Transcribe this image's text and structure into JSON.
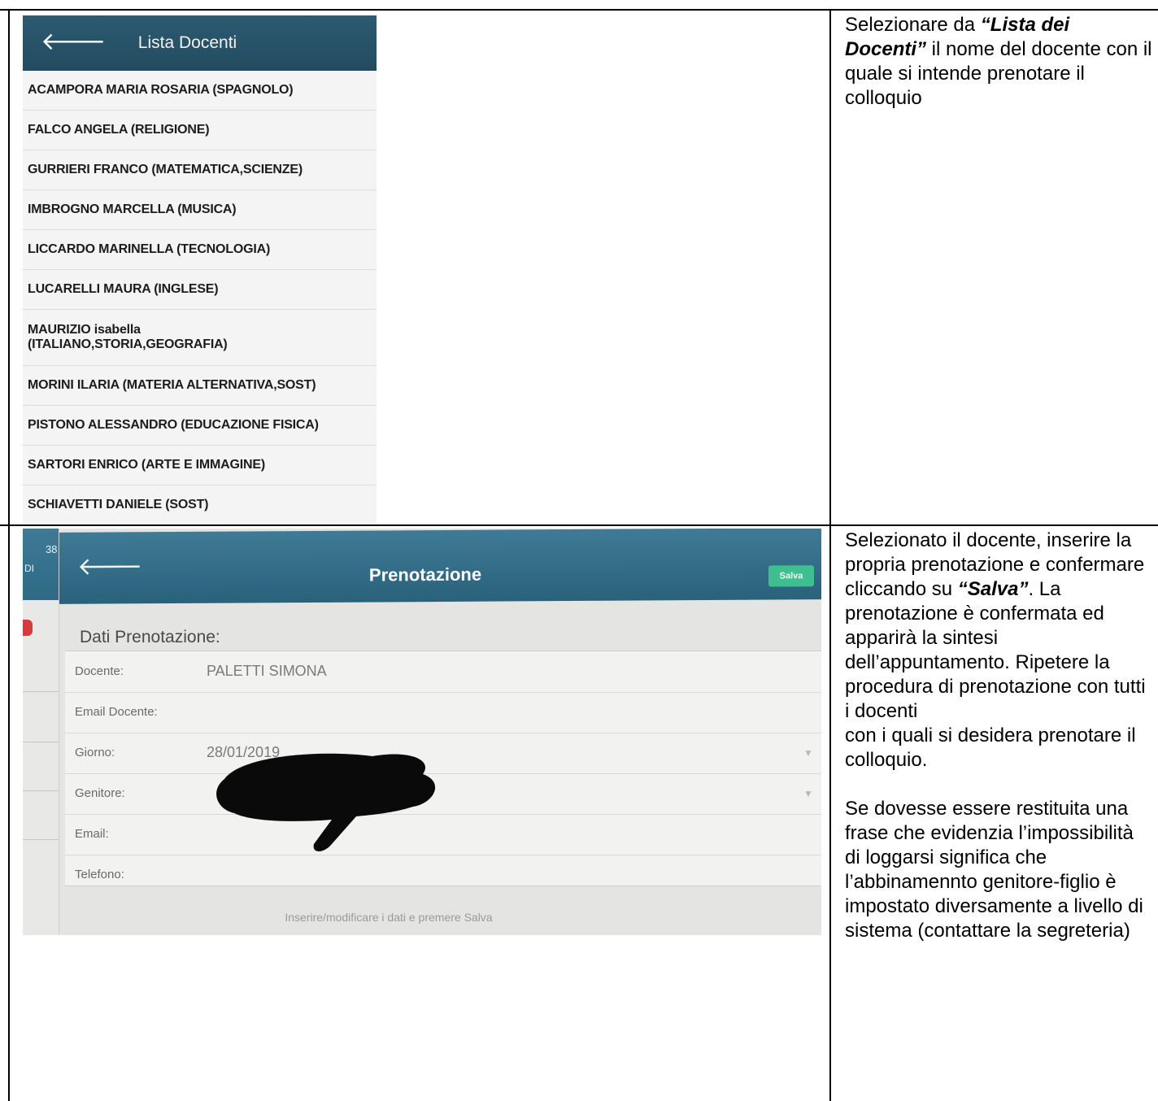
{
  "screenshot_list": {
    "title": "Lista Docenti",
    "back_icon": "arrow-left-icon",
    "teachers": [
      "ACAMPORA MARIA ROSARIA (SPAGNOLO)",
      "FALCO ANGELA (RELIGIONE)",
      "GURRIERI FRANCO (MATEMATICA,SCIENZE)",
      "IMBROGNO MARCELLA (MUSICA)",
      "LICCARDO MARINELLA (TECNOLOGIA)",
      "LUCARELLI MAURA (INGLESE)",
      "MAURIZIO isabella\n(ITALIANO,STORIA,GEOGRAFIA)",
      "MORINI ILARIA (MATERIA ALTERNATIVA,SOST)",
      "PISTONO ALESSANDRO (EDUCAZIONE FISICA)",
      "SARTORI ENRICO (ARTE E IMMAGINE)",
      "SCHIAVETTI DANIELE (SOST)"
    ]
  },
  "screenshot_booking": {
    "sidebar_mini": "38",
    "sidebar_mini2": "DI",
    "title": "Prenotazione",
    "save_label": "Salva",
    "section_title": "Dati Prenotazione:",
    "fields": {
      "docente_label": "Docente:",
      "docente_value": "PALETTI SIMONA",
      "email_docente_label": "Email Docente:",
      "giorno_label": "Giorno:",
      "giorno_value": "28/01/2019",
      "genitore_label": "Genitore:",
      "email_label": "Email:",
      "telefono_label": "Telefono:"
    },
    "footnote": "Inserire/modificare i dati e premere Salva"
  },
  "instructions": {
    "step1_pre": "Selezionare da ",
    "step1_em": "“Lista dei Docenti”",
    "step1_post": " il nome del docente con il quale si intende prenotare il colloquio",
    "step2_pre": "Selezionato il docente, inserire la propria prenotazione e confermare cliccando su ",
    "step2_em": "“Salva”",
    "step2_post": ". La prenotazione è confermata ed apparirà la sintesi dell’appuntamento. Ripetere la procedura di prenotazione con tutti i docenti",
    "step2_line2": "con i quali si desidera prenotare il colloquio.",
    "note": "Se dovesse essere restituita una frase che evidenzia l’impossibilità di loggarsi significa che l’abbinamennto genitore-figlio è impostato diversamente a livello di sistema (contattare la segreteria)"
  }
}
